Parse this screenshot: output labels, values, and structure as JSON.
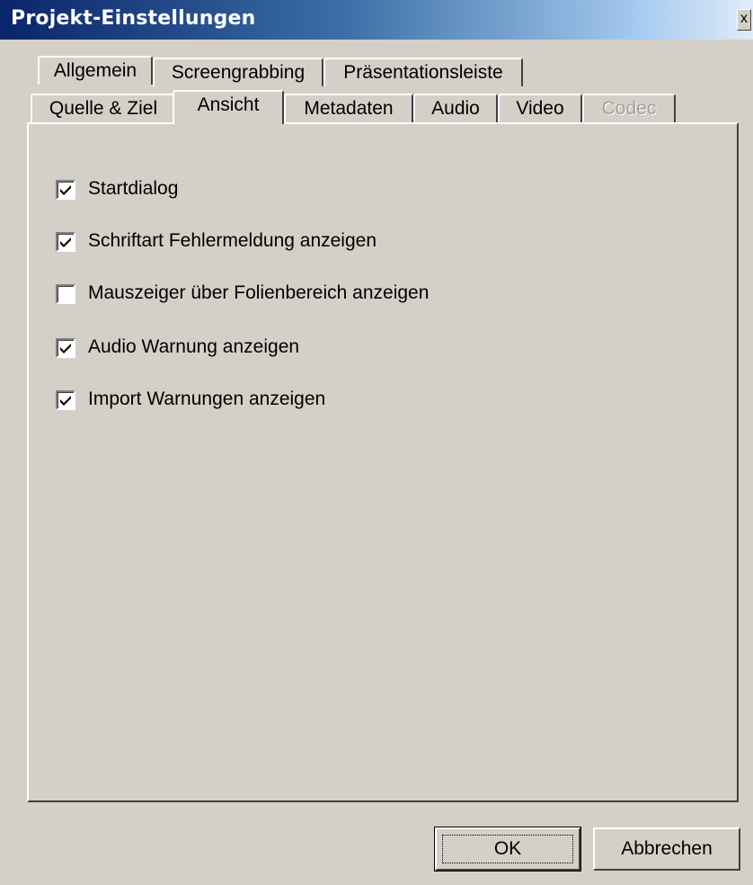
{
  "window": {
    "title": "Projekt-Einstellungen",
    "close_label": "x"
  },
  "tabs_row1": [
    {
      "label": "Allgemein",
      "active": true
    },
    {
      "label": "Screengrabbing",
      "active": false
    },
    {
      "label": "Präsentationsleiste",
      "active": false
    }
  ],
  "tabs_row2": [
    {
      "label": "Quelle & Ziel",
      "enabled": true
    },
    {
      "label": "Ansicht",
      "enabled": true,
      "selected": true
    },
    {
      "label": "Metadaten",
      "enabled": true
    },
    {
      "label": "Audio",
      "enabled": true
    },
    {
      "label": "Video",
      "enabled": true
    },
    {
      "label": "Codec",
      "enabled": false
    }
  ],
  "options": [
    {
      "label": "Startdialog",
      "checked": true
    },
    {
      "label": "Schriftart Fehlermeldung anzeigen",
      "checked": true
    },
    {
      "label": "Mauszeiger über Folienbereich anzeigen",
      "checked": false
    },
    {
      "label": "Audio Warnung anzeigen",
      "checked": true
    },
    {
      "label": "Import Warnungen anzeigen",
      "checked": true
    }
  ],
  "buttons": {
    "ok_label": "OK",
    "cancel_label": "Abbrechen"
  },
  "colors": {
    "dialog_background": "#d4d0c8",
    "titlebar_start": "#0a246a",
    "titlebar_end": "#a6caf0",
    "disabled_text": "#a0a0a0"
  }
}
